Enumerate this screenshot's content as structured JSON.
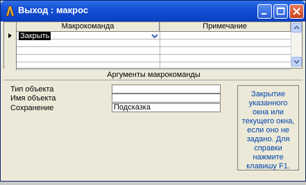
{
  "window": {
    "title": "Выход : макрос",
    "title_icon": "access-icon",
    "buttons": [
      "minimize-icon",
      "maximize-icon",
      "close-icon"
    ]
  },
  "grid": {
    "columns": [
      "Макрокоманда",
      "Примечание"
    ],
    "rows": [
      {
        "action": "Закрыть",
        "note": ""
      }
    ],
    "selected_row_indicator": "arrow-right-icon"
  },
  "arguments": {
    "section_title": "Аргументы макрокоманды",
    "fields": [
      {
        "label": "Тип объекта",
        "value": ""
      },
      {
        "label": "Имя объекта",
        "value": ""
      },
      {
        "label": "Сохранение",
        "value": "Подсказка"
      }
    ],
    "help_text": "Закрытие указанного окна или текущего окна, если оно не задано. Для справки нажмите клавишу F1."
  },
  "colors": {
    "titlebar": "#1550d6",
    "help_text": "#0044aa",
    "window_bg": "#ece9d8"
  }
}
